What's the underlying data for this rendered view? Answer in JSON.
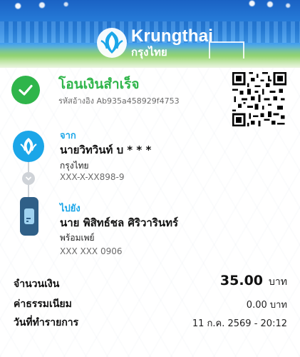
{
  "brand": {
    "name_en": "Krungthai",
    "name_th": "กรุงไทย"
  },
  "status": {
    "title": "โอนเงินสำเร็จ",
    "reference": "รหัสอ้างอิง Ab935a458929f4753",
    "icon": "check-icon",
    "color": "#2fb54a"
  },
  "from": {
    "label": "จาก",
    "name": "นายวิทวินท์ บ * * *",
    "bank": "กรุงไทย",
    "account": "XXX-X-XX898-9"
  },
  "to": {
    "label": "ไปยัง",
    "name": "นาย พิสิทธ์ชล ศิริวารินทร์",
    "bank": "พร้อมเพย์",
    "account": "XXX XXX 0906"
  },
  "summary": {
    "amount_label": "จำนวนเงิน",
    "amount_value": "35.00",
    "amount_unit": "บาท",
    "fee_label": "ค่าธรรมเนียม",
    "fee_value": "0.00 บาท",
    "date_label": "วันที่ทำรายการ",
    "date_value": "11 ก.ค. 2569 - 20:12"
  },
  "colors": {
    "accent_blue": "#1ba6e8",
    "success_green": "#2fb54a",
    "phone_navy": "#2f5f87"
  }
}
